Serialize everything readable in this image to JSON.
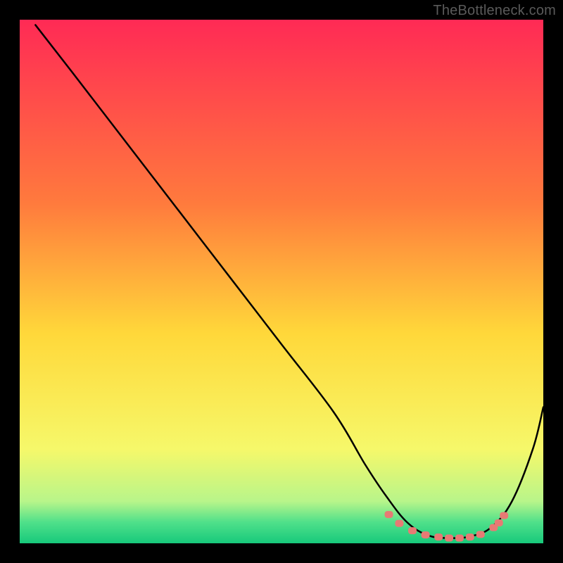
{
  "watermark": "TheBottleneck.com",
  "colors": {
    "bg": "#000000",
    "curve": "#000000",
    "marker_fill": "#e77a74",
    "marker_stroke": "#c95a55",
    "grad_top": "#ff2a55",
    "grad_mid1": "#ff7a3d",
    "grad_mid2": "#ffd83a",
    "grad_mid3": "#f6f86a",
    "grad_green_top": "#b8f58a",
    "grad_green_mid": "#4fe08a",
    "grad_green_bot": "#17c97b"
  },
  "chart_data": {
    "type": "line",
    "title": "",
    "xlabel": "",
    "ylabel": "",
    "xlim": [
      0,
      100
    ],
    "ylim": [
      0,
      100
    ],
    "curve": {
      "x": [
        3,
        10,
        20,
        30,
        40,
        50,
        60,
        66,
        70,
        74,
        78,
        82,
        86,
        90,
        94,
        98,
        100
      ],
      "y": [
        99,
        90,
        77,
        64,
        51,
        38,
        25,
        15,
        9,
        4,
        1.5,
        1,
        1.3,
        3,
        8,
        18,
        26
      ]
    },
    "markers": {
      "x": [
        70.5,
        72.5,
        75,
        77.5,
        80,
        82,
        84,
        86,
        88,
        90.5,
        91.5,
        92.5
      ],
      "y": [
        5.5,
        3.8,
        2.4,
        1.6,
        1.2,
        1.0,
        1.0,
        1.2,
        1.7,
        3.0,
        3.9,
        5.3
      ]
    }
  }
}
